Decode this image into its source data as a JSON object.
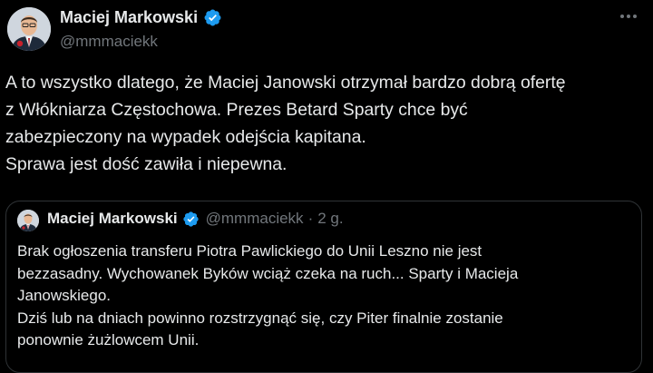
{
  "author": {
    "display_name": "Maciej Markowski",
    "handle": "@mmmaciekk",
    "verified_icon": "verified-badge-icon",
    "verified_color": "#1d9bf0"
  },
  "more_icon": "more-options-icon",
  "tweet": {
    "lines": [
      "A to wszystko dlatego, że Maciej Janowski otrzymał bardzo dobrą ofertę",
      "z Włókniarza Częstochowa. Prezes Betard Sparty chce być",
      "zabezpieczony na wypadek odejścia kapitana.",
      "Sprawa jest dość zawiła i niepewna."
    ]
  },
  "quoted": {
    "display_name": "Maciej Markowski",
    "handle": "@mmmaciekk",
    "separator": "·",
    "time": "2 g.",
    "lines": [
      "Brak ogłoszenia transferu Piotra Pawlickiego do Unii Leszno nie jest",
      "bezzasadny. Wychowanek Byków wciąż czeka na ruch... Sparty i Macieja",
      "Janowskiego.",
      "Dziś lub na dniach powinno rozstrzygnąć się, czy Piter finalnie zostanie",
      "ponownie żużlowcem Unii."
    ]
  },
  "colors": {
    "background": "#000000",
    "text": "#e7e9ea",
    "secondary": "#71767b",
    "border": "#2f3336"
  }
}
